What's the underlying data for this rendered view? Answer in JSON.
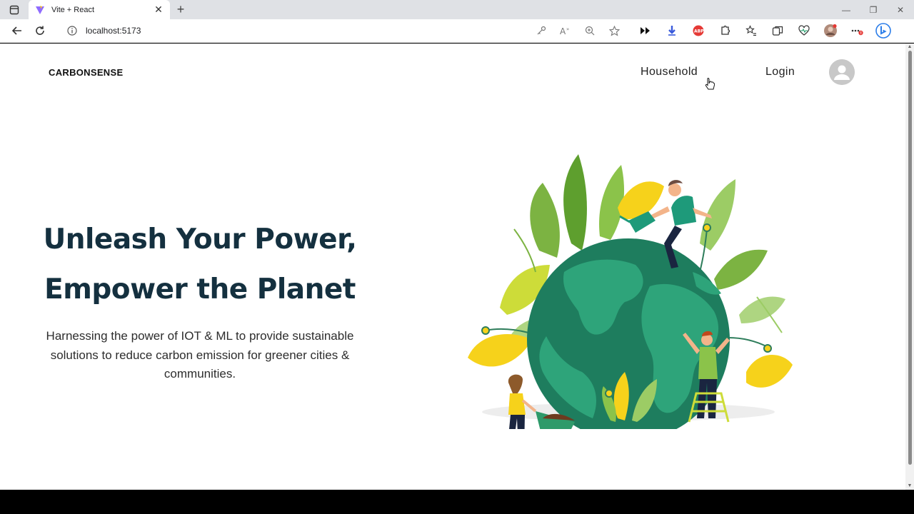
{
  "browser": {
    "tab_title": "Vite + React",
    "url": "localhost:5173",
    "new_tab": "+",
    "close_tab": "✕",
    "window_controls": {
      "minimize": "—",
      "restore": "❐",
      "close": "✕"
    }
  },
  "nav": {
    "brand": "CARBONSENSE",
    "links": {
      "household": "Household",
      "login": "Login"
    }
  },
  "hero": {
    "title_line1": "Unleash Your Power,",
    "title_line2": "Empower the Planet",
    "subtitle": "Harnessing the power of IOT & ML to provide sustainable solutions to reduce carbon emission for greener cities & communities."
  },
  "colors": {
    "title": "#14303f",
    "globe_ocean": "#1e8a6a",
    "globe_land": "#2ea47a",
    "leaf_yellow": "#f6d21b",
    "leaf_green": "#9bc53d"
  }
}
